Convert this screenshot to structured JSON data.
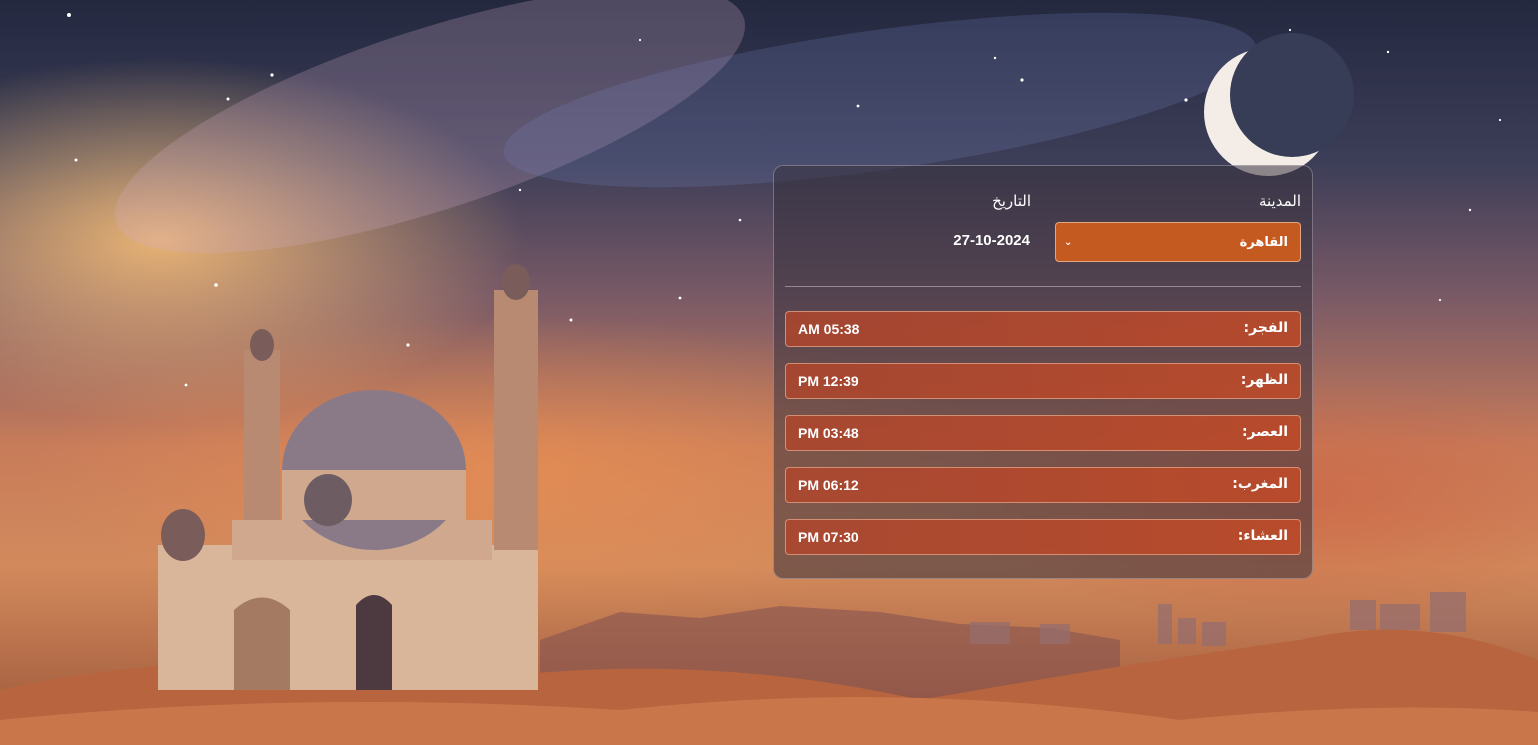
{
  "form": {
    "city_label": "المدينة",
    "city_value": "القاهرة",
    "date_label": "التاريخ",
    "date_value": "27-10-2024"
  },
  "prayers": [
    {
      "name": "الفجر:",
      "time": "AM 05:38"
    },
    {
      "name": "الظهر:",
      "time": "PM 12:39"
    },
    {
      "name": "العصر:",
      "time": "PM 03:48"
    },
    {
      "name": "المغرب:",
      "time": "PM 06:12"
    },
    {
      "name": "العشاء:",
      "time": "PM 07:30"
    }
  ],
  "colors": {
    "accent": "#c45a1f",
    "row": "#b9492c",
    "panel": "#37323e"
  },
  "icons": {
    "select_arrow": "chevron-down-icon"
  }
}
